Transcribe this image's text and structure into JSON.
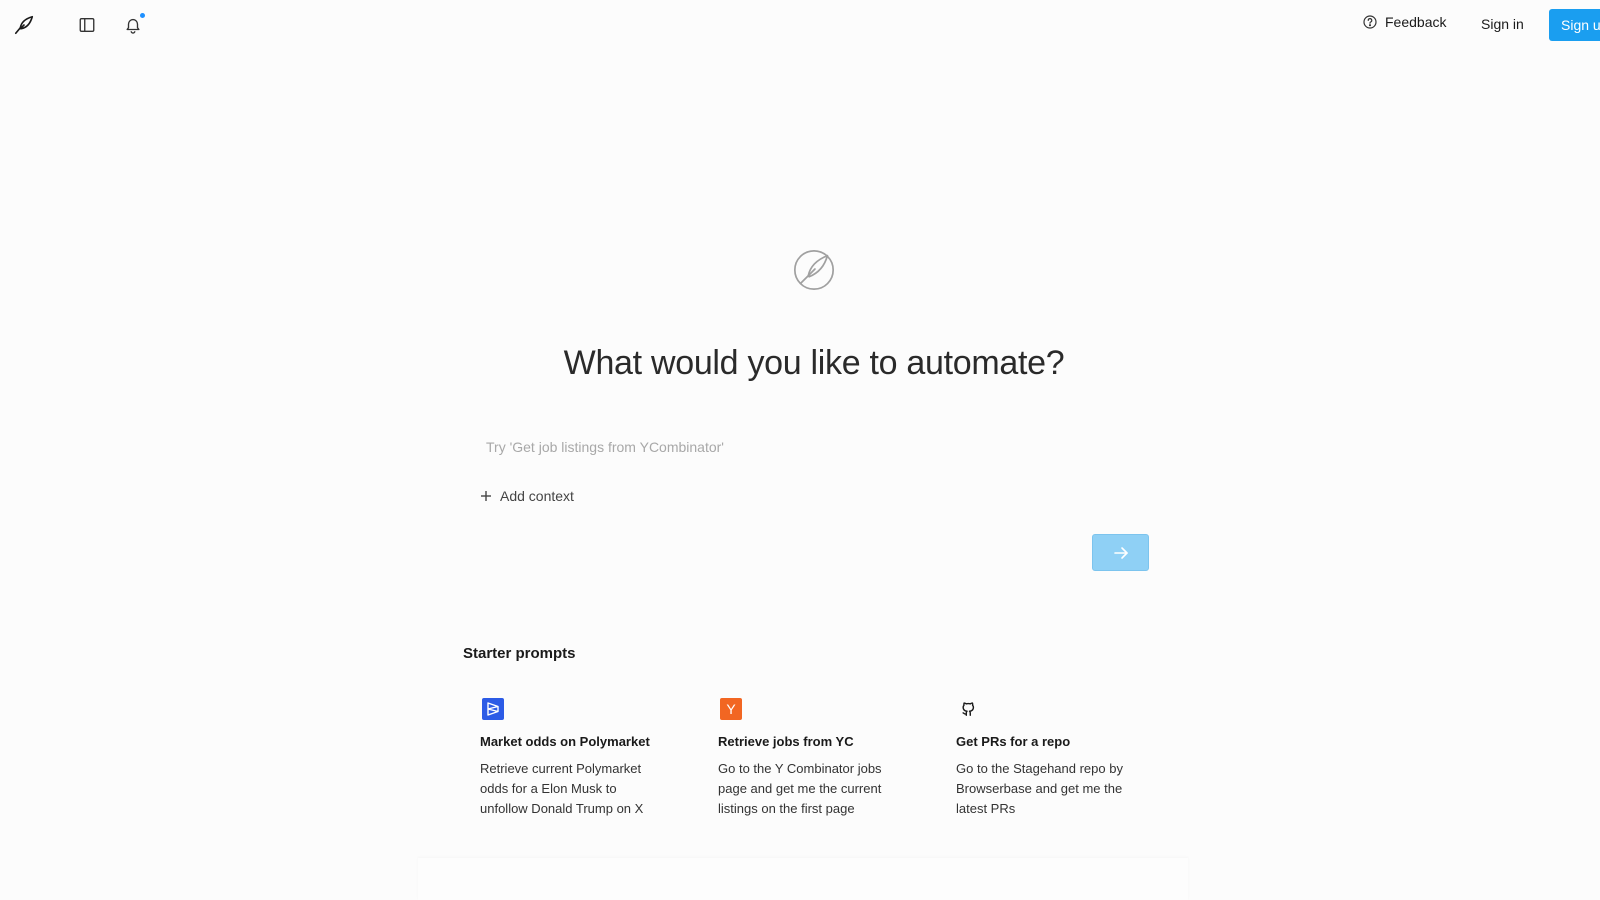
{
  "header": {
    "feedback_label": "Feedback",
    "signin_label": "Sign in",
    "signup_label": "Sign up"
  },
  "main": {
    "headline": "What would you like to automate?",
    "prompt_placeholder": "Try 'Get job listings from YCombinator'",
    "add_context_label": "Add context"
  },
  "starter": {
    "title": "Starter prompts",
    "cards": [
      {
        "icon": "polymarket-icon",
        "title": "Market odds on Polymarket",
        "description": "Retrieve current Polymarket odds for a Elon Musk to unfollow Donald Trump on X"
      },
      {
        "icon": "ycombinator-icon",
        "icon_text": "Y",
        "title": "Retrieve jobs from YC",
        "description": "Go to the Y Combinator jobs page and get me the current listings on the first page"
      },
      {
        "icon": "github-icon",
        "title": "Get PRs for a repo",
        "description": "Go to the Stagehand repo by Browserbase and get me the latest PRs"
      }
    ]
  },
  "colors": {
    "accent": "#1a9ef0",
    "submit_disabled": "#8fd0f5",
    "notification_dot": "#1e90ff",
    "polymarket_blue": "#2c5be6",
    "yc_orange": "#f26622"
  }
}
